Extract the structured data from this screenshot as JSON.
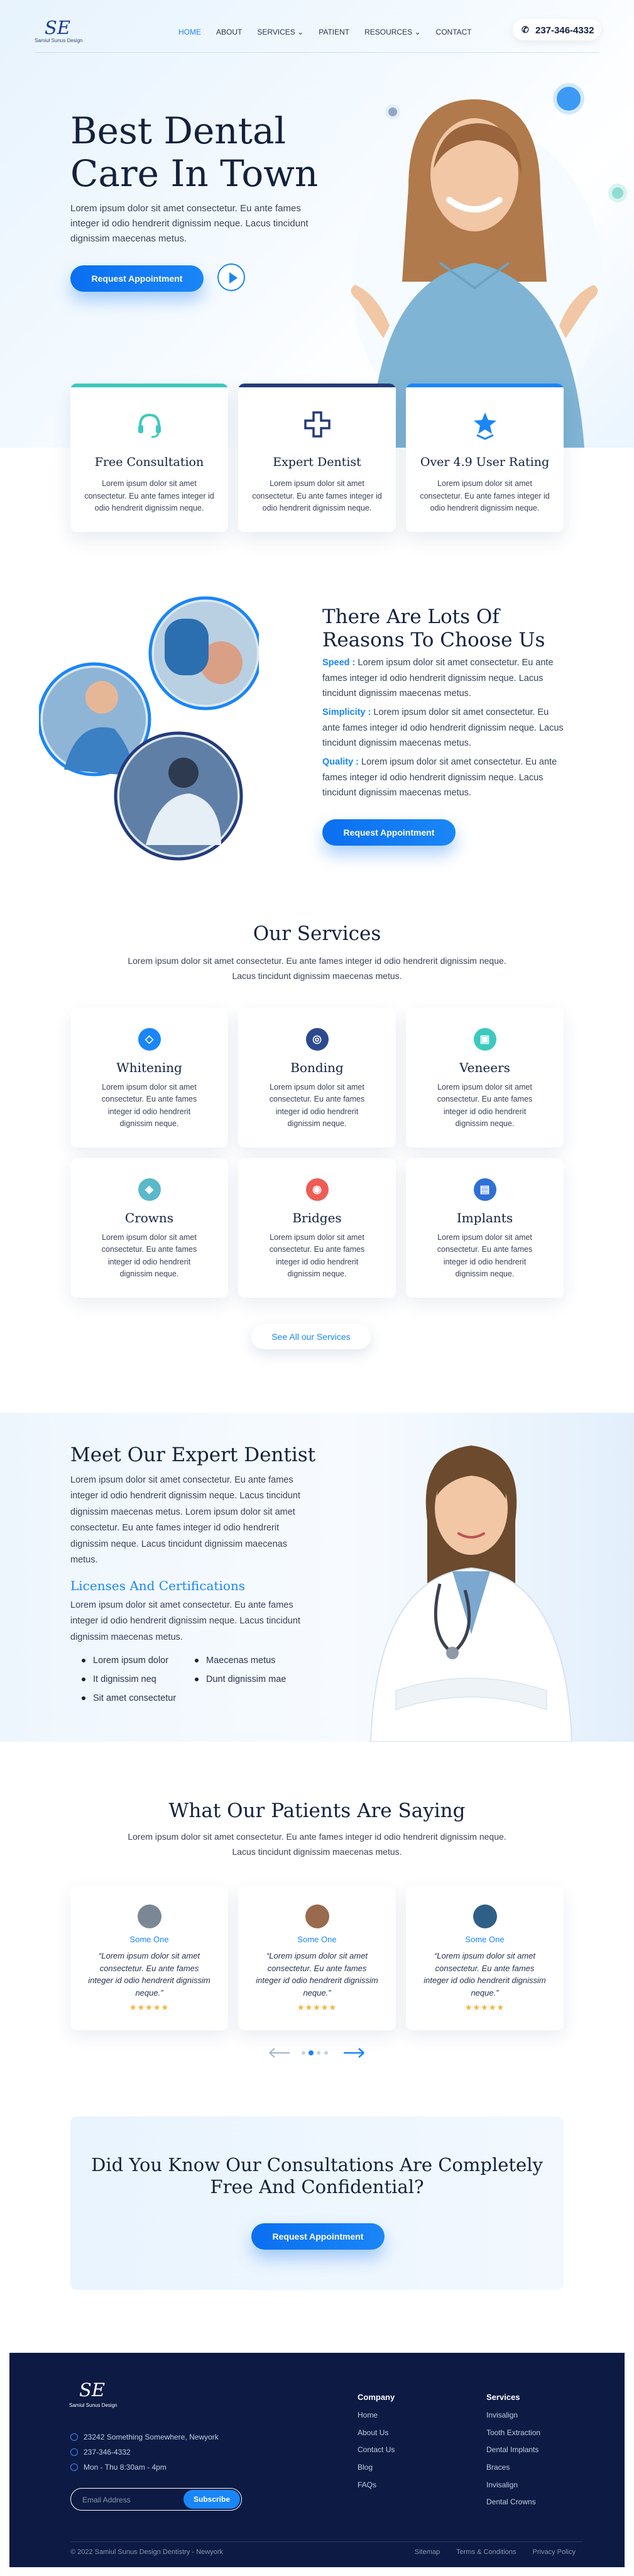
{
  "brand": {
    "mark": "SE",
    "sub": "Samiul Sunus Design"
  },
  "nav": {
    "items": [
      "HOME",
      "ABOUT",
      "SERVICES",
      "PATIENT",
      "RESOURCES",
      "CONTACT"
    ],
    "phone": "237-346-4332"
  },
  "hero": {
    "title": "Best Dental Care In Town",
    "text": "Lorem ipsum dolor sit amet consectetur. Eu ante fames integer id odio hendrerit dignissim neque. Lacus tincidunt dignissim maecenas metus.",
    "button": "Request Appointment"
  },
  "features": [
    {
      "title": "Free Consultation",
      "text": "Lorem ipsum dolor sit amet consectetur. Eu ante fames integer id odio hendrerit dignissim neque.",
      "color": "#3cc9bd"
    },
    {
      "title": "Expert Dentist",
      "text": "Lorem ipsum dolor sit amet consectetur. Eu ante fames integer id odio hendrerit dignissim neque.",
      "color": "#233b7a"
    },
    {
      "title": "Over 4.9 User Rating",
      "text": "Lorem ipsum dolor sit amet consectetur. Eu ante fames integer id odio hendrerit dignissim neque.",
      "color": "#1a86f7"
    }
  ],
  "choose": {
    "title": "There Are Lots Of Reasons To Choose Us",
    "items": [
      {
        "label": "Speed :",
        "text": " Lorem ipsum dolor sit amet consectetur. Eu ante fames integer id odio hendrerit dignissim neque. Lacus tincidunt dignissim maecenas metus."
      },
      {
        "label": "Simplicity :",
        "text": " Lorem ipsum dolor sit amet consectetur. Eu ante fames integer id odio hendrerit dignissim neque. Lacus tincidunt dignissim maecenas metus."
      },
      {
        "label": "Quality :",
        "text": " Lorem ipsum dolor sit amet consectetur. Eu ante fames integer id odio hendrerit dignissim neque. Lacus tincidunt dignissim maecenas metus."
      }
    ],
    "button": "Request Appointment"
  },
  "services": {
    "title": "Our Services",
    "subtitle": "Lorem ipsum dolor sit amet consectetur. Eu ante fames integer id odio hendrerit dignissim neque. Lacus tincidunt dignissim maecenas metus.",
    "items": [
      {
        "title": "Whitening",
        "text": "Lorem ipsum dolor sit amet consectetur. Eu ante fames integer id odio hendrerit dignissim neque.",
        "color": "#1a86f7",
        "icon": "◇"
      },
      {
        "title": "Bonding",
        "text": "Lorem ipsum dolor sit amet consectetur. Eu ante fames integer id odio hendrerit dignissim neque.",
        "color": "#2c4a8f",
        "icon": "◎"
      },
      {
        "title": "Veneers",
        "text": "Lorem ipsum dolor sit amet consectetur. Eu ante fames integer id odio hendrerit dignissim neque.",
        "color": "#3cc9bd",
        "icon": "▣"
      },
      {
        "title": "Crowns",
        "text": "Lorem ipsum dolor sit amet consectetur. Eu ante fames integer id odio hendrerit dignissim neque.",
        "color": "#5bb8c9",
        "icon": "◈"
      },
      {
        "title": "Bridges",
        "text": "Lorem ipsum dolor sit amet consectetur. Eu ante fames integer id odio hendrerit dignissim neque.",
        "color": "#ee5d55",
        "icon": "◉"
      },
      {
        "title": "Implants",
        "text": "Lorem ipsum dolor sit amet consectetur. Eu ante fames integer id odio hendrerit dignissim neque.",
        "color": "#2f6fd6",
        "icon": "▤"
      }
    ],
    "all": "See All our Services"
  },
  "dentist": {
    "title": "Meet Our Expert Dentist",
    "text": "Lorem ipsum dolor sit amet consectetur. Eu ante fames integer id odio hendrerit dignissim neque. Lacus tincidunt dignissim maecenas metus. Lorem ipsum dolor sit amet consectetur. Eu ante fames integer id odio hendrerit dignissim neque. Lacus tincidunt dignissim maecenas metus.",
    "lic_title": "Licenses And Certifications",
    "lic_text": "Lorem ipsum dolor sit amet consectetur. Eu ante fames integer id odio hendrerit dignissim neque. Lacus tincidunt dignissim maecenas metus.",
    "bullets": [
      "Lorem ipsum dolor",
      "It dignissim neq",
      "Sit amet consectetur",
      "Maecenas metus",
      "Dunt dignissim mae"
    ]
  },
  "testimonials": {
    "title": "What Our Patients Are Saying",
    "subtitle": "Lorem ipsum dolor sit amet consectetur. Eu ante fames integer id odio hendrerit dignissim neque. Lacus tincidunt dignissim maecenas metus.",
    "items": [
      {
        "name": "Some One",
        "quote": "“Lorem ipsum dolor sit amet consectetur. Eu ante fames integer id odio hendrerit dignissim neque.”",
        "stars": "★★★★★"
      },
      {
        "name": "Some One",
        "quote": "“Lorem ipsum dolor sit amet consectetur. Eu ante fames integer id odio hendrerit dignissim neque.”",
        "stars": "★★★★★"
      },
      {
        "name": "Some One",
        "quote": "“Lorem ipsum dolor sit amet consectetur. Eu ante fames integer id odio hendrerit dignissim neque.”",
        "stars": "★★★★★"
      }
    ]
  },
  "cta": {
    "title": "Did You Know Our Consultations Are Completely Free And Confidential?",
    "button": "Request Appointment"
  },
  "footer": {
    "address": "23242 Something Somewhere, Newyork",
    "phone": "237-346-4332",
    "hours": "Mon - Thu 8:30am - 4pm",
    "email_placeholder": "Email Address",
    "subscribe": "Subscribe",
    "company_title": "Company",
    "company": [
      "Home",
      "About Us",
      "Contact Us",
      "Blog",
      "FAQs"
    ],
    "services_title": "Services",
    "services": [
      "Invisalign",
      "Tooth Extraction",
      "Dental Implants",
      "Braces",
      "Invisalign",
      "Dental Crowns"
    ],
    "copyright": "© 2022 Samiul Sunus Design Dentistry - Newyork",
    "links": [
      "Sitemap",
      "Terms & Conditions",
      "Privacy Policy"
    ]
  }
}
